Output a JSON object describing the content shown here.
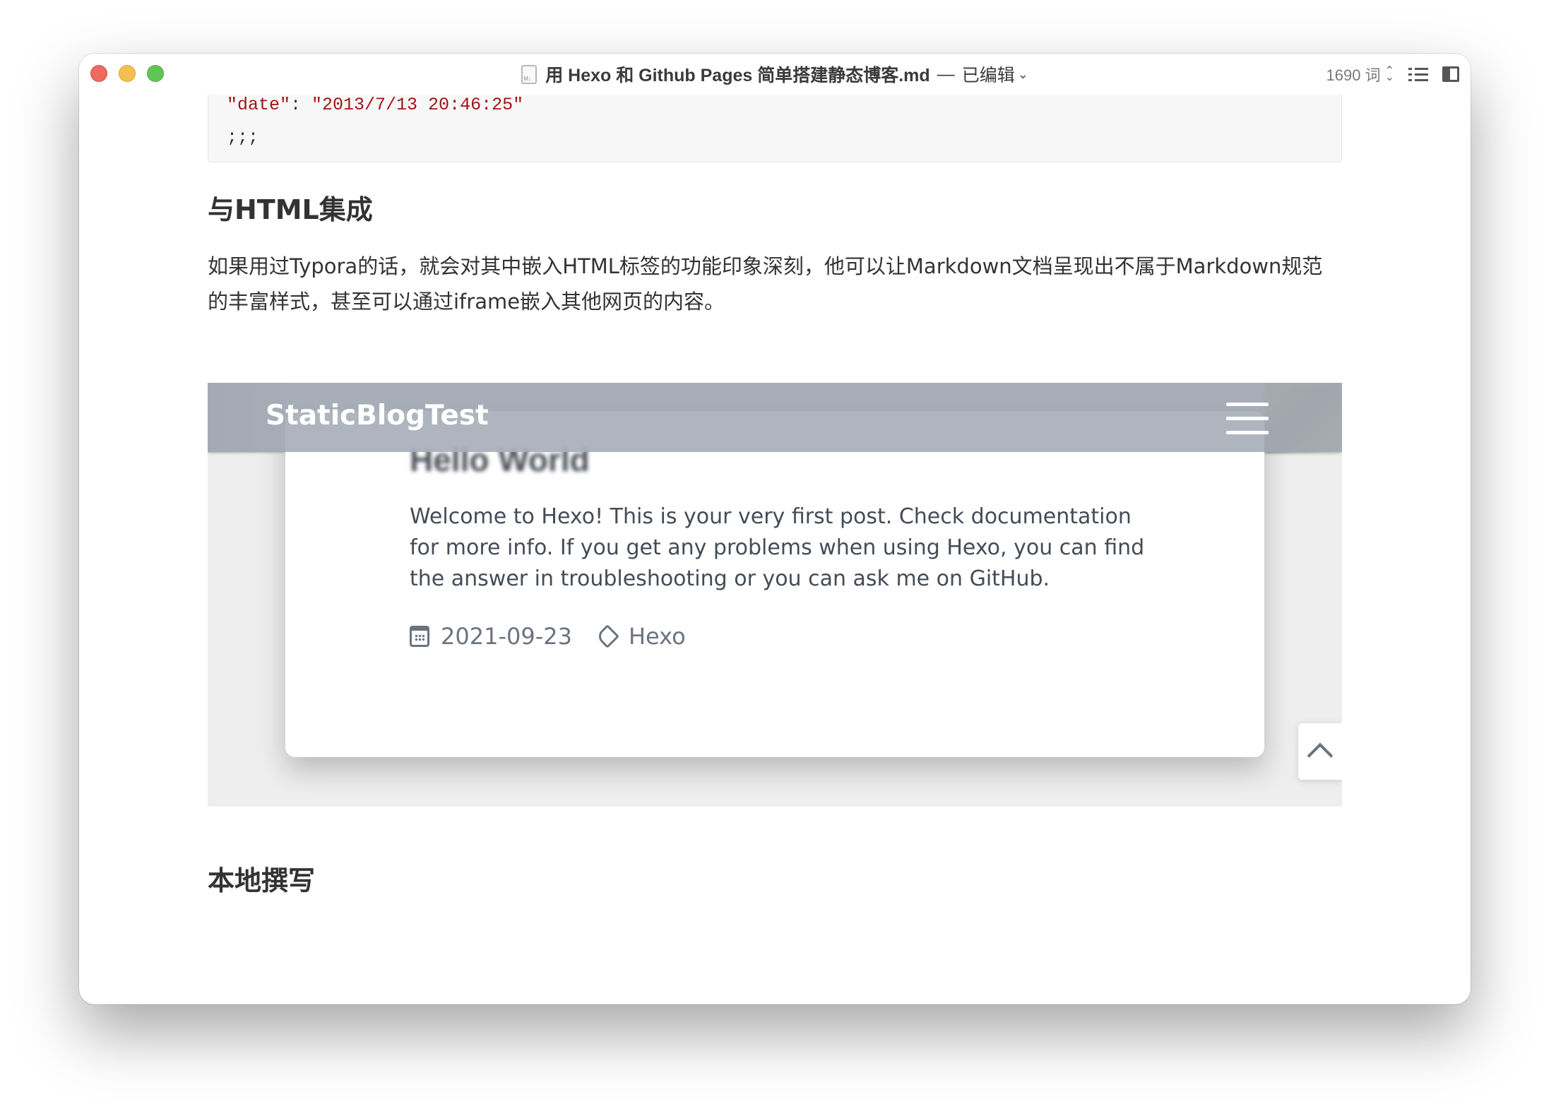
{
  "window": {
    "title": "用 Hexo 和 Github Pages 简单搭建静态博客.md",
    "separator": "—",
    "status": "已编辑",
    "word_count": "1690 词"
  },
  "code": {
    "key": "\"date\"",
    "colon": ": ",
    "value": "\"2013/7/13 20:46:25\"",
    "end_line": ";;;"
  },
  "section1": {
    "heading": "与HTML集成",
    "paragraph": "如果用过Typora的话，就会对其中嵌入HTML标签的功能印象深刻，他可以让Markdown文档呈现出不属于Markdown规范的丰富样式，甚至可以通过iframe嵌入其他网页的内容。"
  },
  "embed": {
    "brand": "StaticBlogTest",
    "post_title": "Hello World",
    "post_body": "Welcome to Hexo! This is your very first post. Check documentation for more info. If you get any problems when using Hexo, you can find the answer in troubleshooting or you can ask me on GitHub.",
    "date": "2021-09-23",
    "tag": "Hexo",
    "icons": {
      "calendar": "calendar-icon",
      "tag": "tag-icon",
      "menu": "hamburger-icon",
      "back_to_top": "chevron-up-icon"
    }
  },
  "section2": {
    "heading": "本地撰写"
  }
}
